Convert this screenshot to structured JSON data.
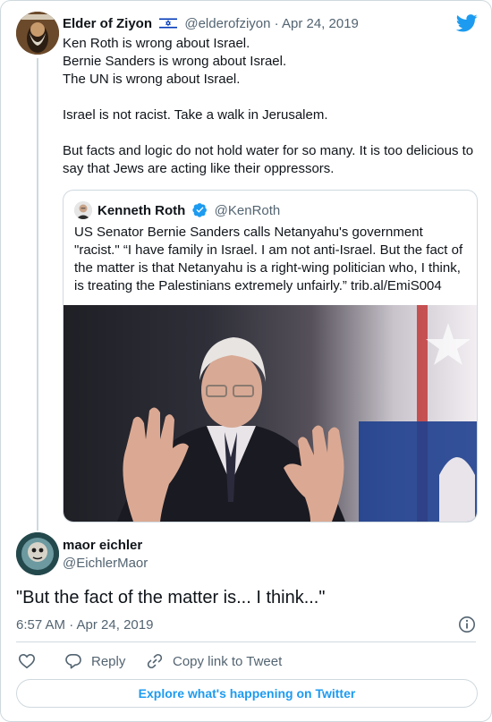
{
  "colors": {
    "accent": "#1d9bf0",
    "border": "#cfd9de",
    "secondary_text": "#536471",
    "primary_text": "#0f1419"
  },
  "tweet": {
    "author_name": "Elder of Ziyon",
    "author_handle": "@elderofziyon",
    "separator": "·",
    "date": "Apr 24, 2019",
    "flag_icon": "israel-flag-icon",
    "text": "Ken Roth is wrong about Israel.\nBernie Sanders is wrong about Israel.\nThe UN is wrong about Israel.\n\nIsrael is not racist. Take a walk in Jerusalem.\n\nBut facts and logic do not hold water for so many. It is too delicious to say that Jews are acting like their oppressors."
  },
  "quoted_tweet": {
    "author_name": "Kenneth Roth",
    "author_handle": "@KenRoth",
    "verified_icon": "verified-badge-icon",
    "text": "US Senator Bernie Sanders calls Netanyahu's government \"racist.\" “I have family in Israel. I am not anti-Israel. But the fact of the matter is that Netanyahu is a right-wing politician who, I think, is treating the Palestinians extremely unfairly.” trib.al/EmiS004",
    "image_icon": "photo-of-speaker-gesturing"
  },
  "reply": {
    "author_name": "maor eichler",
    "author_handle": "@EichlerMaor",
    "text": "\"But the fact of the matter is... I think...\"",
    "timestamp": "6:57 AM · Apr 24, 2019"
  },
  "actions": {
    "like_icon": "heart-icon",
    "reply_icon": "reply-bubble-icon",
    "reply_label": "Reply",
    "copy_icon": "link-icon",
    "copy_label": "Copy link to Tweet",
    "info_icon": "info-icon"
  },
  "explore_button": {
    "label": "Explore what's happening on Twitter"
  },
  "brand": {
    "logo_icon": "twitter-bird-icon"
  }
}
